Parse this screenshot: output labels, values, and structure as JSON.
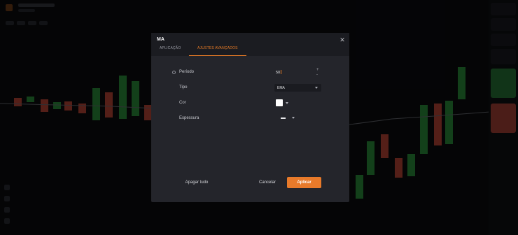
{
  "modal": {
    "title": "MA",
    "close_icon": "close-icon",
    "tabs": [
      {
        "label": "APLICAÇÃO",
        "active": false
      },
      {
        "label": "AJUSTES AVANÇADOS",
        "active": true
      }
    ],
    "fields": {
      "period": {
        "label": "Período",
        "value": "50",
        "icon": "gear-icon"
      },
      "type": {
        "label": "Tipo",
        "value": "EMA"
      },
      "color": {
        "label": "Cor",
        "value": "#ffffff"
      },
      "thickness": {
        "label": "Espessura"
      }
    },
    "buttons": {
      "clear": "Apagar tudo",
      "cancel": "Cancelar",
      "apply": "Aplicar"
    }
  },
  "colors": {
    "accent": "#e87a2a",
    "up": "#2f9a3f",
    "down": "#c84b3a",
    "modal_bg": "#24252b",
    "page_bg": "#0c0d10"
  }
}
